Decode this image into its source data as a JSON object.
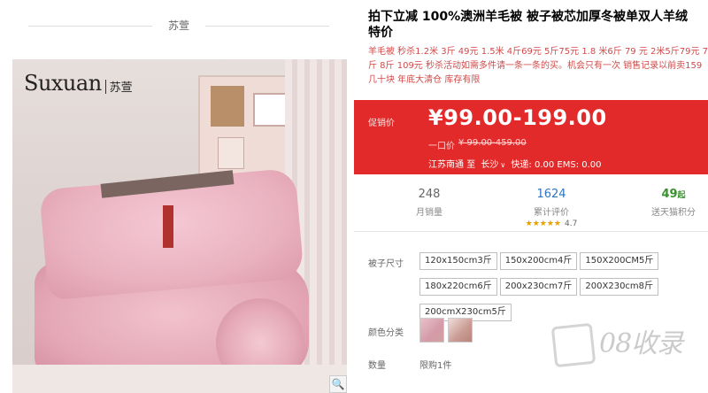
{
  "brand_header": {
    "name": "苏萱"
  },
  "logo": {
    "latin": "Suxuan",
    "cn": "苏萱"
  },
  "gallery": {
    "zoom_icon": "magnifier-icon",
    "zoom_glyph": "🔍"
  },
  "product": {
    "title_line1": "拍下立减 100%澳洲羊毛被 被子被芯加厚冬被单双人羊绒",
    "title_line2": "特价",
    "subtitle": "羊毛被 秒杀1.2米 3斤 49元 1.5米 4斤69元 5斤75元 1.8 米6斤 79 元 2米5斤79元 7斤 8斤 109元 秒杀活动如需多件请一条一条的买。机会只有一次 销售记录以前卖159 几十块 年底大清仓 库存有限"
  },
  "price": {
    "label": "促销价",
    "value": "¥99.00-199.00",
    "original_label": "一口价",
    "original_value": "¥ 99.00-459.00",
    "ship_from": "江苏南通",
    "ship_to_word": "至",
    "city": "长沙",
    "express": "快递: 0.00 EMS: 0.00"
  },
  "stats": {
    "monthly_sales": {
      "value": "248",
      "label": "月销量"
    },
    "reviews": {
      "value": "1624",
      "label": "累计评价",
      "rating_stars": "★★★★★",
      "rating": "4.7"
    },
    "points": {
      "value": "49",
      "unit": "起",
      "label": "送天猫积分"
    }
  },
  "options": {
    "size_label": "被子尺寸",
    "sizes": [
      "120x150cm3斤",
      "150x200cm4斤",
      "150X200CM5斤",
      "180x220cm6斤",
      "200x230cm7斤",
      "200X230cm8斤",
      "200cmX230cm5斤"
    ],
    "color_label": "颜色分类",
    "quantity_label": "数量",
    "quantity_value": "限购1件"
  },
  "watermark": {
    "text": "08收录"
  },
  "colors": {
    "price_bg": "#e32a2a",
    "review_count": "#2f74c0",
    "points": "#3a8f2f",
    "subtitle": "#d34a4a"
  }
}
